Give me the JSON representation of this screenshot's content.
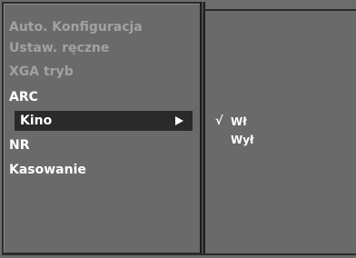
{
  "menu": {
    "items": [
      {
        "label": "Auto. Konfiguracja",
        "state": "disabled"
      },
      {
        "label": "Ustaw. ręczne",
        "state": "disabled"
      },
      {
        "label": "XGA tryb",
        "state": "disabled"
      },
      {
        "label": "ARC",
        "state": "enabled"
      },
      {
        "label": "Kino",
        "state": "selected"
      },
      {
        "label": "NR",
        "state": "enabled"
      },
      {
        "label": "Kasowanie",
        "state": "enabled"
      }
    ]
  },
  "submenu": {
    "check_mark": "√",
    "options": [
      {
        "label": "Wł",
        "checked": true
      },
      {
        "label": "Wył",
        "checked": false
      }
    ]
  },
  "colors": {
    "panel": "#6a6a6a",
    "selected_bar": "#2a2a2a",
    "disabled_text": "#a2a2a2",
    "enabled_text": "#ffffff"
  }
}
